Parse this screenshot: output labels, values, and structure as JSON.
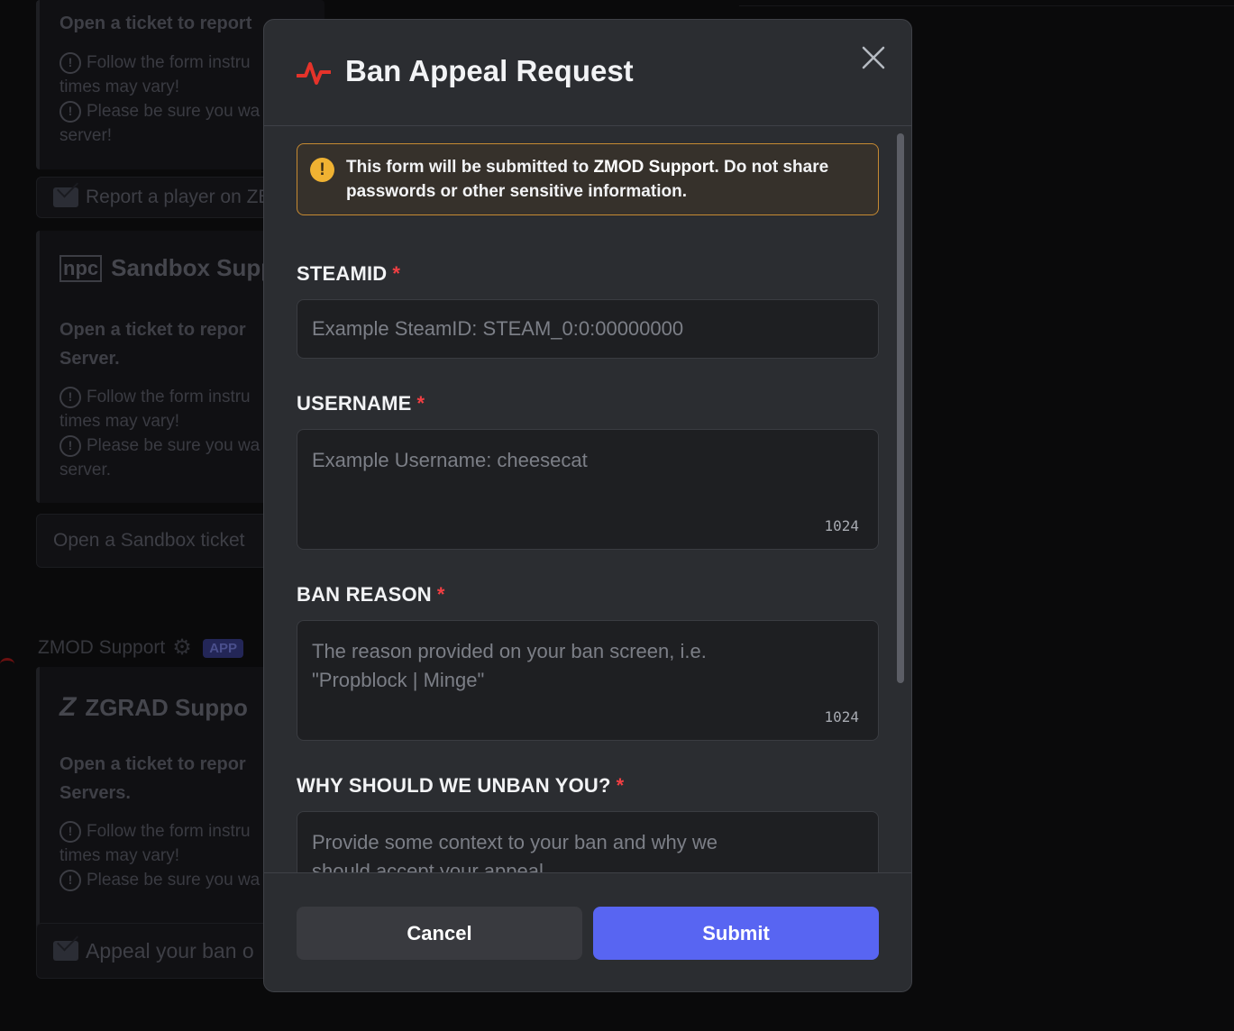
{
  "background": {
    "embed1": {
      "title_partial": "Open a ticket to report",
      "line1": "Follow the form instru",
      "line1b": "times may vary!",
      "line2": "Please be sure you wa",
      "line2b": "server!",
      "button": "Report a player on ZB"
    },
    "embed2": {
      "title": "Sandbox Supp",
      "bold1": "Open a ticket to repor",
      "bold2": "Server.",
      "line1": "Follow the form instru",
      "line1b": "times may vary!",
      "line2": "Please be sure you wa",
      "line2b": "server.",
      "button": "Open a Sandbox ticket"
    },
    "author": {
      "name": "ZMOD Support",
      "badge": "APP"
    },
    "embed3": {
      "title": "ZGRAD Suppo",
      "bold1": "Open a ticket to repor",
      "bold2": "Servers.",
      "line1": "Follow the form instru",
      "line1b": "times may vary!",
      "line2": "Please be sure you wa",
      "button": "Appeal your ban o"
    }
  },
  "modal": {
    "title": "Ban Appeal Request",
    "notice": {
      "prefix": "This form will be submitted to ",
      "strong": "ZMOD Support",
      "suffix": ". Do not share passwords or other sensitive information."
    },
    "fields": [
      {
        "label": "STEAMID",
        "required_mark": "*",
        "placeholder": "Example SteamID: STEAM_0:0:00000000"
      },
      {
        "label": "USERNAME",
        "required_mark": "*",
        "placeholder": "Example Username: cheesecat",
        "max": "1024"
      },
      {
        "label": "BAN REASON",
        "required_mark": "*",
        "placeholder": "The reason provided on your ban screen, i.e.\n\"Propblock | Minge\"",
        "max": "1024"
      },
      {
        "label": "WHY SHOULD WE UNBAN YOU?",
        "required_mark": "*",
        "placeholder": "Provide some context to your ban and why we\nshould accept your appeal."
      }
    ],
    "cancel_label": "Cancel",
    "submit_label": "Submit"
  },
  "colors": {
    "accent": "#5865f2",
    "warning": "#f0b232",
    "required": "#f23f43",
    "title_icon": "#e5332a"
  }
}
